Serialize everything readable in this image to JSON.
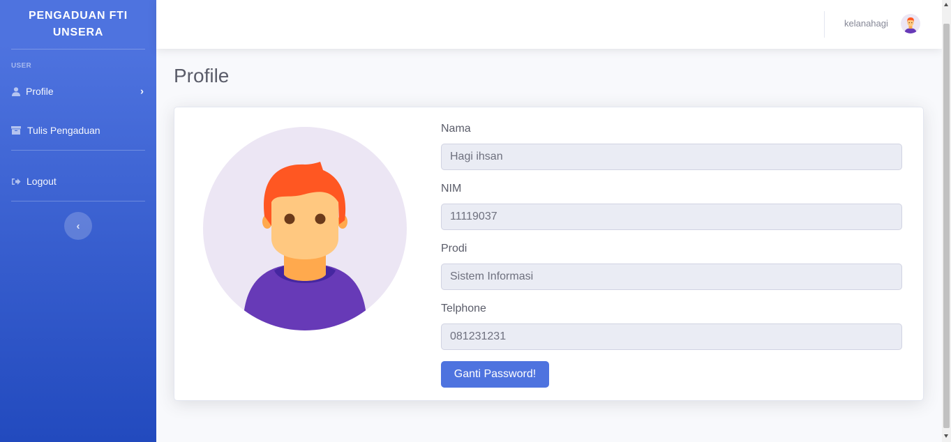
{
  "sidebar": {
    "brand": "PENGADUAN FTI UNSERA",
    "heading": "USER",
    "items": [
      {
        "label": "Profile",
        "icon": "user-icon"
      },
      {
        "label": "Tulis Pengaduan",
        "icon": "archive-icon"
      },
      {
        "label": "Logout",
        "icon": "sign-out-icon"
      }
    ],
    "toggle_icon": "chevron-left-icon"
  },
  "topbar": {
    "username": "kelanahagi",
    "avatar_icon": "user-avatar-icon"
  },
  "main": {
    "title": "Profile",
    "fields": [
      {
        "label": "Nama",
        "value": "Hagi ihsan"
      },
      {
        "label": "NIM",
        "value": "11119037"
      },
      {
        "label": "Prodi",
        "value": "Sistem Informasi"
      },
      {
        "label": "Telphone",
        "value": "081231231"
      }
    ],
    "button_label": "Ganti Password!"
  },
  "colors": {
    "primary": "#4e73df",
    "sidebar_gradient_end": "#224abe",
    "input_bg": "#eaecf4",
    "text_gray": "#5a5c69"
  }
}
